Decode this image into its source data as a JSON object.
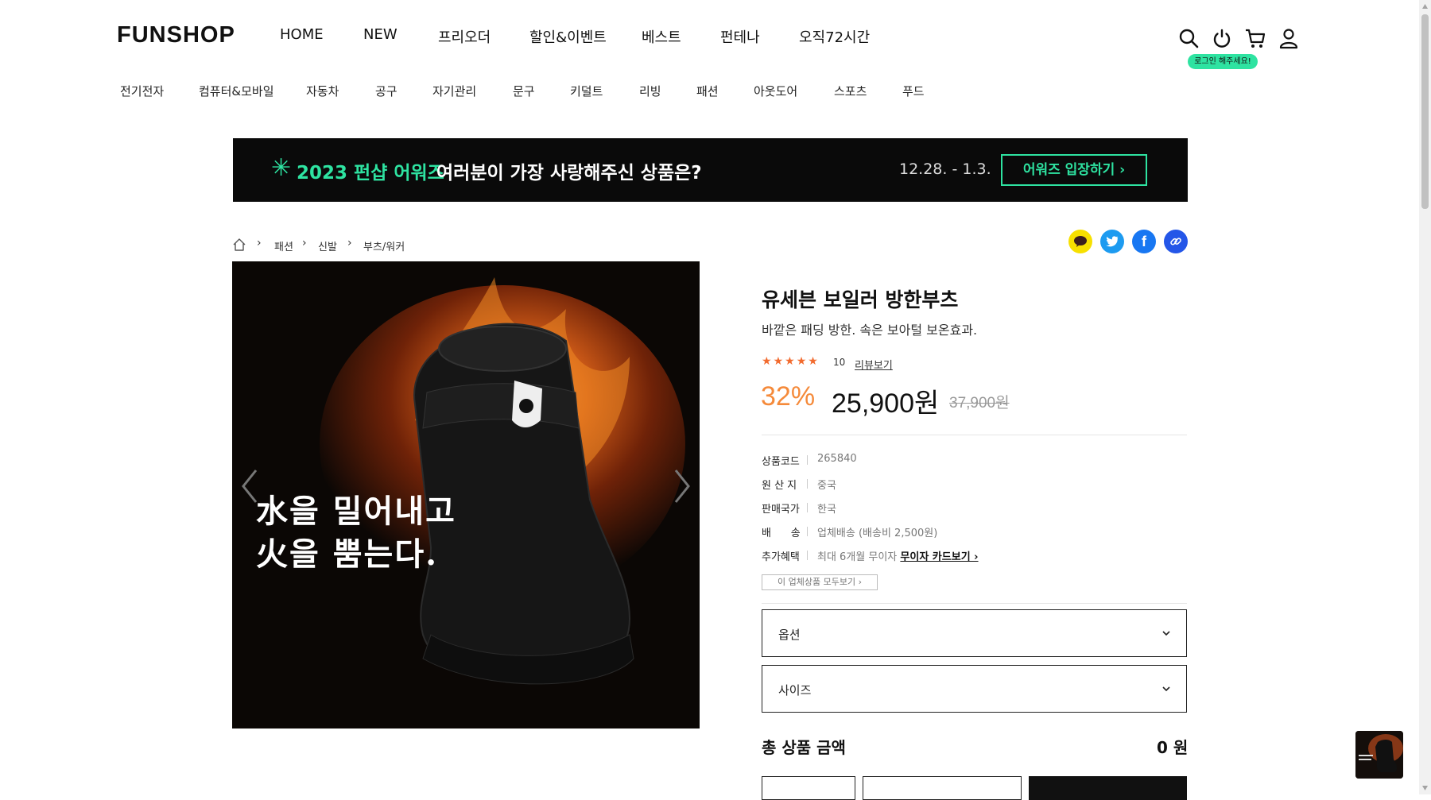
{
  "header": {
    "logo": "FUNSHOP",
    "gnb": [
      "HOME",
      "NEW",
      "프리오더",
      "할인&이벤트",
      "베스트",
      "펀테나",
      "오직72시간"
    ],
    "login_badge": "로그인 해주세요!",
    "icons": [
      "search-icon",
      "power-icon",
      "cart-icon",
      "user-icon"
    ]
  },
  "categories": [
    "전기전자",
    "컴퓨터&모바일",
    "자동차",
    "공구",
    "자기관리",
    "문구",
    "키덜트",
    "리빙",
    "패션",
    "아웃도어",
    "스포츠",
    "푸드"
  ],
  "banner": {
    "star": "✳",
    "title": "2023 펀샵 어워즈",
    "subtitle": "여러분이 가장 사랑해주신 상품은?",
    "date": "12.28. - 1.3.",
    "cta": "어워즈 입장하기 ›"
  },
  "breadcrumb": [
    "패션",
    "신발",
    "부츠/워커"
  ],
  "share_icons": [
    "kakao-icon",
    "twitter-icon",
    "facebook-icon",
    "link-icon"
  ],
  "product": {
    "image_caption": "水을 밀어내고\n火을 뿜는다.",
    "title": "유세븐 보일러 방한부츠",
    "description": "바깥은 패딩 방한. 속은 보아털 보온효과.",
    "rating_stars": 5,
    "review_count": "10",
    "review_link": "리뷰보기",
    "discount": "32%",
    "price": "25,900원",
    "original_price": "37,900원"
  },
  "specs": [
    {
      "key": "상품코드",
      "value": "265840"
    },
    {
      "key": "원 산 지",
      "value": "중국"
    },
    {
      "key": "판매국가",
      "value": "한국"
    },
    {
      "key": "배      송",
      "value": "업체배송 (배송비 2,500원)"
    },
    {
      "key": "추가혜택",
      "value": "최대 6개월 무이자",
      "link": "무이자 카드보기 ›"
    }
  ],
  "vendor_button": "이 업체상품 모두보기 ›",
  "options": {
    "option_label": "옵션",
    "size_label": "사이즈"
  },
  "total": {
    "label": "총 상품 금액",
    "value": "0 원"
  },
  "colors": {
    "accent_green": "#2ee3a1",
    "discount_orange": "#f58a3a",
    "star_orange": "#f26b2f"
  }
}
